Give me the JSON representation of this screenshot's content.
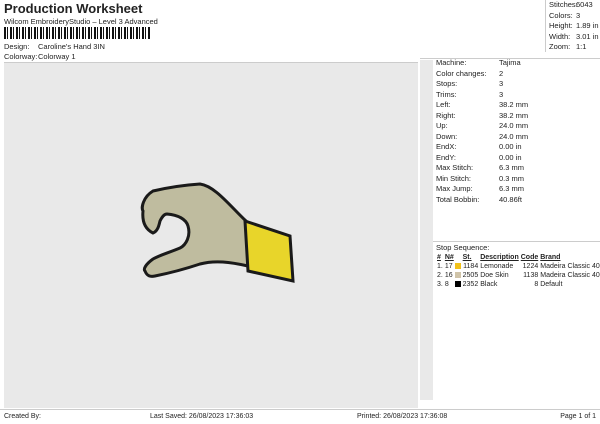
{
  "header": {
    "title": "Production Worksheet",
    "subtitle": "Wilcom EmbroideryStudio – Level 3 Advanced",
    "design_label": "Design:",
    "design": "Caroline's Hand 3IN",
    "colorway_label": "Colorway:",
    "colorway": "Colorway 1"
  },
  "stats": [
    {
      "k": "Stitches:",
      "v": "6043"
    },
    {
      "k": "Colors:",
      "v": "3"
    },
    {
      "k": "Height:",
      "v": "1.89 in"
    },
    {
      "k": "Width:",
      "v": "3.01 in"
    },
    {
      "k": "Zoom:",
      "v": "1:1"
    }
  ],
  "info": [
    {
      "k": "Machine:",
      "v": "Tajima"
    },
    {
      "k": "Color changes:",
      "v": "2"
    },
    {
      "k": "Stops:",
      "v": "3"
    },
    {
      "k": "Trims:",
      "v": "3"
    },
    {
      "k": "Left:",
      "v": "38.2 mm"
    },
    {
      "k": "Right:",
      "v": "38.2 mm"
    },
    {
      "k": "Up:",
      "v": "24.0 mm"
    },
    {
      "k": "Down:",
      "v": "24.0 mm"
    },
    {
      "k": "EndX:",
      "v": "0.00 in"
    },
    {
      "k": "EndY:",
      "v": "0.00 in"
    },
    {
      "k": "Max Stitch:",
      "v": "6.3 mm"
    },
    {
      "k": "Min Stitch:",
      "v": "0.3 mm"
    },
    {
      "k": "Max Jump:",
      "v": "6.3 mm"
    },
    {
      "k": "Total Bobbin:",
      "v": "40.86ft"
    }
  ],
  "stop_sequence": {
    "title": "Stop Sequence:",
    "headers": [
      "#",
      "N#",
      "St.",
      "Description",
      "Code",
      "Brand"
    ],
    "rows": [
      {
        "n": "1.",
        "nn": "17",
        "color": "#f2c21b",
        "st": "1184",
        "desc": "Lemonade",
        "code": "1224",
        "brand": "Madeira Classic 40"
      },
      {
        "n": "2.",
        "nn": "16",
        "color": "#cfc3a8",
        "st": "2505",
        "desc": "Doe Skin",
        "code": "1138",
        "brand": "Madeira Classic 40"
      },
      {
        "n": "3.",
        "nn": "8",
        "color": "#000000",
        "st": "2352",
        "desc": "Black",
        "code": "8",
        "brand": "Default"
      }
    ]
  },
  "footer": {
    "created": "Created By:",
    "saved": "Last Saved: 26/08/2023 17:36:03",
    "printed": "Printed: 26/08/2023 17:36:08",
    "page": "Page 1 of 1"
  }
}
